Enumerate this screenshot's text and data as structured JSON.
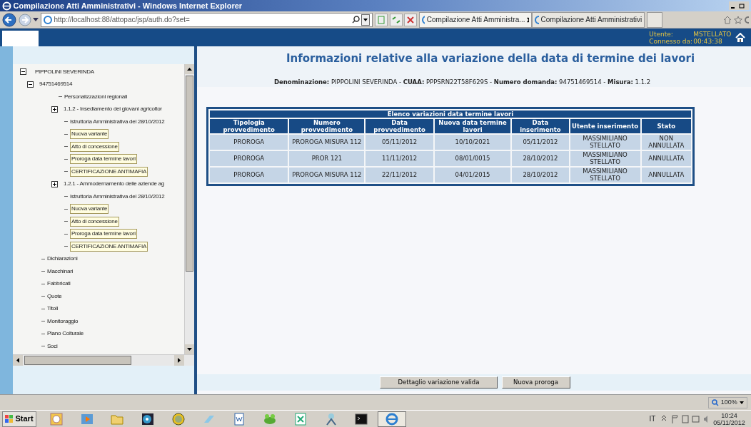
{
  "window": {
    "title": "Compilazione Atti Amministrativi - Windows Internet Explorer"
  },
  "browser": {
    "address": "http://localhost:88/attopac/jsp/auth.do?set=",
    "tabs": [
      {
        "label": "Compilazione Atti Amministra...",
        "selected": true
      },
      {
        "label": "Compilazione Atti Amministrativi",
        "selected": false
      }
    ]
  },
  "header": {
    "user_label": "Utente:",
    "user": "MSTELLATO",
    "connected_label": "Connesso da:",
    "connected": "00:43:38"
  },
  "tree": [
    {
      "label": "PIPPOLINI SEVERINDA",
      "expanded": true,
      "highlighted": false,
      "children": [
        {
          "label": "94751469514",
          "expanded": true,
          "highlighted": false,
          "children": [
            {
              "label": "Personalizzazioni regionali",
              "highlighted": false
            },
            {
              "label": "1.1.2 - Insediamento dei giovani agricoltor",
              "expanded": false,
              "highlighted": false,
              "children": [
                {
                  "label": "Istruttoria Amministrativa del 28/10/2012",
                  "highlighted": false
                },
                {
                  "label": "Nuova variante",
                  "highlighted": true
                },
                {
                  "label": "Atto di concessione",
                  "highlighted": true
                },
                {
                  "label": "Proroga data termine lavori",
                  "highlighted": true
                },
                {
                  "label": "CERTIFICAZIONE ANTIMAFIA",
                  "highlighted": true
                }
              ]
            },
            {
              "label": "1.2.1 - Ammodernamento delle aziende ag",
              "expanded": false,
              "highlighted": false,
              "children": [
                {
                  "label": "Istruttoria Amministrativa del 28/10/2012",
                  "highlighted": false
                },
                {
                  "label": "Nuova variante",
                  "highlighted": true
                },
                {
                  "label": "Atto di concessione",
                  "highlighted": true
                },
                {
                  "label": "Proroga data termine lavori",
                  "highlighted": true
                },
                {
                  "label": "CERTIFICAZIONE ANTIMAFIA",
                  "highlighted": true
                }
              ]
            }
          ]
        },
        {
          "label": "Dichiarazioni",
          "highlighted": false
        },
        {
          "label": "Macchinari",
          "highlighted": false
        },
        {
          "label": "Fabbricati",
          "highlighted": false
        },
        {
          "label": "Quote",
          "highlighted": false
        },
        {
          "label": "Titoli",
          "highlighted": false
        },
        {
          "label": "Monitoraggio",
          "highlighted": false
        },
        {
          "label": "Piano Colturale",
          "highlighted": false
        },
        {
          "label": "Soci",
          "highlighted": false
        }
      ]
    }
  ],
  "page": {
    "title": "Informazioni relative alla variazione della data di termine dei lavori",
    "info": "**Denominazione:** PIPPOLINI SEVERINDA - **CUAA:** PPPSRN22T58F629S - **Numero domanda:** 94751469514 - **Misura:** 1.1.2"
  },
  "table": {
    "caption": "Elenco variazioni data termine lavori",
    "columns": [
      "Tipologia provvedimento",
      "Numero provvedimento",
      "Data provvedimento",
      "Nuova data termine lavori",
      "Data inserimento",
      "Utente inserimento",
      "Stato"
    ],
    "rows": [
      [
        "PROROGA",
        "PROROGA MISURA 112",
        "05/11/2012",
        "10/10/2021",
        "05/11/2012",
        "MASSIMILIANO STELLATO",
        "NON ANNULLATA"
      ],
      [
        "PROROGA",
        "PROR 121",
        "11/11/2012",
        "08/01/0015",
        "28/10/2012",
        "MASSIMILIANO STELLATO",
        "ANNULLATA"
      ],
      [
        "PROROGA",
        "PROROGA MISURA 112",
        "22/11/2012",
        "04/01/2015",
        "28/10/2012",
        "MASSIMILIANO STELLATO",
        "ANNULLATA"
      ]
    ]
  },
  "buttons": [
    "Dettaglio variazione valida",
    "Nuova proroga"
  ],
  "status_bar": {
    "zoom": "100%"
  },
  "taskbar": {
    "start": "Start",
    "apps": [
      {
        "kind": "calendar",
        "selected": false
      },
      {
        "kind": "media",
        "selected": false
      },
      {
        "kind": "folder",
        "selected": false
      },
      {
        "kind": "disc",
        "selected": false
      },
      {
        "kind": "coin",
        "selected": false
      },
      {
        "kind": "eraser",
        "selected": false
      },
      {
        "kind": "document",
        "selected": false
      },
      {
        "kind": "frog",
        "selected": false
      },
      {
        "kind": "sheet",
        "selected": false
      },
      {
        "kind": "network",
        "selected": false
      },
      {
        "kind": "terminal",
        "selected": false
      },
      {
        "kind": "browser",
        "selected": true
      }
    ],
    "language": "IT",
    "time": "10:24",
    "date": "05/11/2012"
  }
}
